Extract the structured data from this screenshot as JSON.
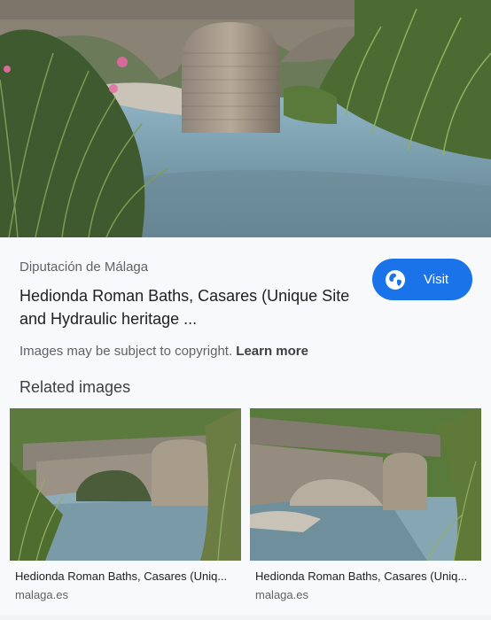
{
  "source": "Diputación de Málaga",
  "title": "Hedionda Roman Baths, Casares (Unique Site and Hydraulic heritage ...",
  "visit_label": "Visit",
  "copyright": {
    "text": "Images may be subject to copyright. ",
    "link": "Learn more"
  },
  "related_heading": "Related images",
  "related": [
    {
      "caption": "Hedionda Roman Baths, Casares (Uniq...",
      "site": "malaga.es"
    },
    {
      "caption": "Hedionda Roman Baths, Casares (Uniq...",
      "site": "malaga.es"
    }
  ],
  "colors": {
    "accent": "#1a73e8",
    "background": "#f8f9fa"
  }
}
